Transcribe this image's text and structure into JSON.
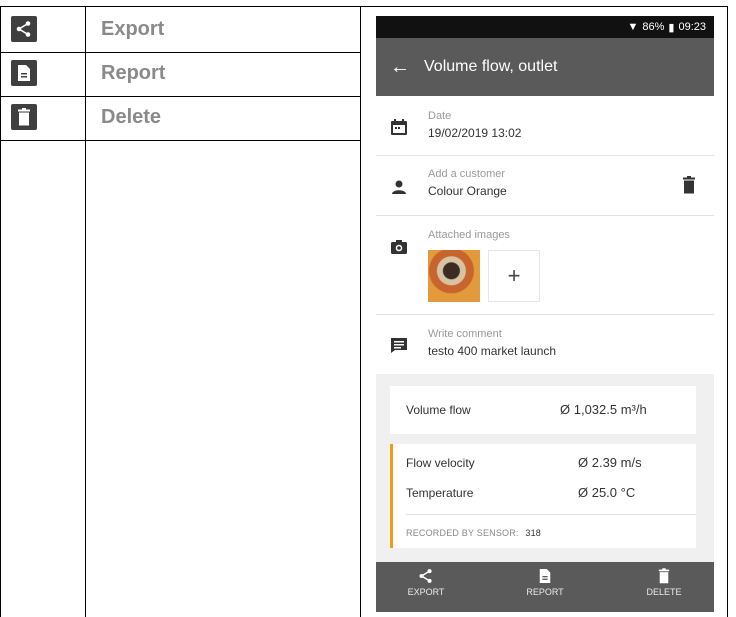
{
  "table": {
    "rows": [
      {
        "icon": "share-icon",
        "label": "Export"
      },
      {
        "icon": "report-icon",
        "label": "Report"
      },
      {
        "icon": "trash-icon",
        "label": "Delete"
      }
    ]
  },
  "status": {
    "battery": "86%",
    "time": "09:23"
  },
  "header": {
    "title": "Volume flow, outlet",
    "back_icon": "back-arrow-icon"
  },
  "date": {
    "caption": "Date",
    "value": "19/02/2019 13:02"
  },
  "customer": {
    "caption": "Add a customer",
    "value": "Colour Orange"
  },
  "images": {
    "caption": "Attached images",
    "add_label": "+"
  },
  "comment": {
    "caption": "Write comment",
    "value": "testo 400 market launch"
  },
  "results": {
    "volume_flow": {
      "label": "Volume flow",
      "value": "Ø 1,032.5 m³/h"
    },
    "flow_velocity": {
      "label": "Flow velocity",
      "value": "Ø 2.39 m/s"
    },
    "temperature": {
      "label": "Temperature",
      "value": "Ø 25.0 °C"
    },
    "sensor": {
      "label": "RECORDED BY SENSOR:",
      "id": "318"
    }
  },
  "bottom_bar": {
    "export": "EXPORT",
    "report": "REPORT",
    "delete": "DELETE"
  },
  "colors": {
    "accent": "#f29a14",
    "bar": "#5a5a5a"
  }
}
